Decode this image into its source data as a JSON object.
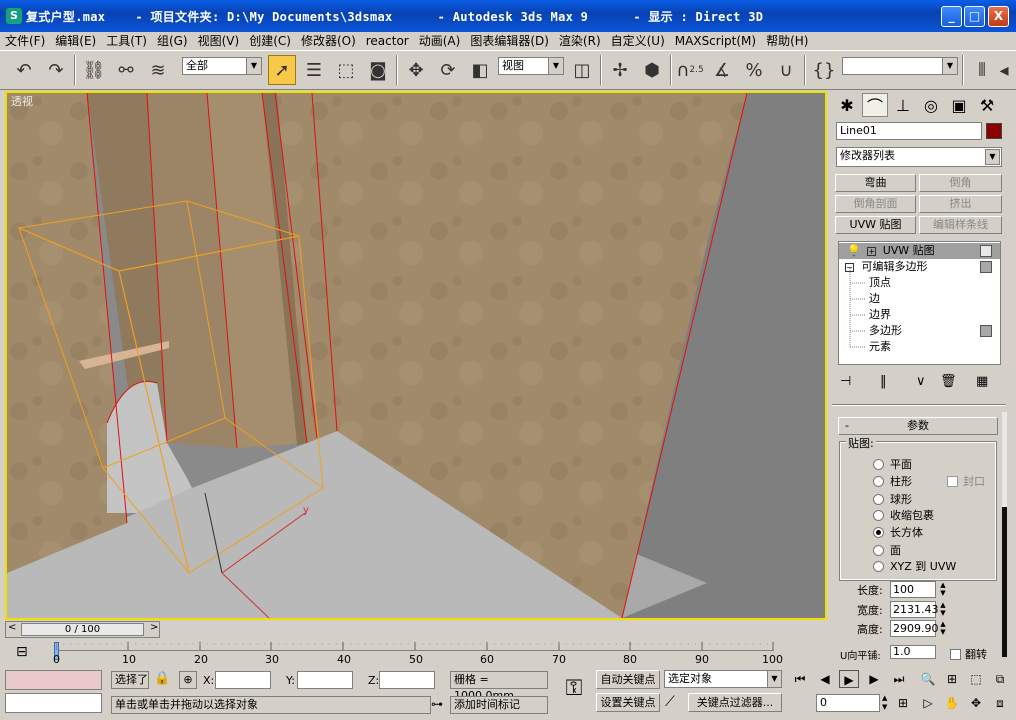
{
  "window": {
    "title": "复式户型.max    - 项目文件夹: D:\\My Documents\\3dsmax      - Autodesk 3ds Max 9      - 显示 : Direct 3D",
    "minimize": "_",
    "maximize": "□",
    "close": "X"
  },
  "menu": [
    "文件(F)",
    "编辑(E)",
    "工具(T)",
    "组(G)",
    "视图(V)",
    "创建(C)",
    "修改器(O)",
    "reactor",
    "动画(A)",
    "图表编辑器(D)",
    "渲染(R)",
    "自定义(U)",
    "MAXScript(M)",
    "帮助(H)"
  ],
  "toolbar": {
    "selection_filter": "全部",
    "coord_system": "视图",
    "named_selection": "",
    "snap_value": "2.5"
  },
  "viewport": {
    "label": "透视",
    "gizmo_axis": "y"
  },
  "panel": {
    "object_name": "Line01",
    "object_color": "#8b0000",
    "modifier_list": "修改器列表",
    "buttons": [
      {
        "label": "弯曲",
        "enabled": true
      },
      {
        "label": "倒角",
        "enabled": false
      },
      {
        "label": "倒角剖面",
        "enabled": false
      },
      {
        "label": "挤出",
        "enabled": false
      },
      {
        "label": "UVW 贴图",
        "enabled": true
      },
      {
        "label": "编辑样条线",
        "enabled": false
      }
    ],
    "stack": [
      {
        "label": "UVW 贴图",
        "level": 0,
        "selected": true
      },
      {
        "label": "可编辑多边形",
        "level": 0,
        "selected": false
      },
      {
        "label": "顶点",
        "level": 1
      },
      {
        "label": "边",
        "level": 1
      },
      {
        "label": "边界",
        "level": 1
      },
      {
        "label": "多边形",
        "level": 1
      },
      {
        "label": "元素",
        "level": 1
      }
    ],
    "rollout_title": "参数",
    "rollout_toggle": "-",
    "mapping_group": "贴图:",
    "mapping_options": [
      {
        "label": "平面",
        "checked": false
      },
      {
        "label": "柱形",
        "checked": false
      },
      {
        "label": "球形",
        "checked": false
      },
      {
        "label": "收缩包裹",
        "checked": false
      },
      {
        "label": "长方体",
        "checked": true
      },
      {
        "label": "面",
        "checked": false
      },
      {
        "label": "XYZ 到 UVW",
        "checked": false
      }
    ],
    "cap_label": "封口",
    "length_label": "长度:",
    "length_value": "100",
    "width_label": "宽度:",
    "width_value": "2131.43",
    "height_label": "高度:",
    "height_value": "2909.90",
    "utile_label": "U向平铺:",
    "utile_value": "1.0",
    "flip_label": "翻转"
  },
  "timeline": {
    "frame": "0 / 100",
    "ticks": [
      "0",
      "10",
      "20",
      "30",
      "40",
      "50",
      "60",
      "70",
      "80",
      "90",
      "100"
    ]
  },
  "status": {
    "selection": "选择了",
    "x_label": "X:",
    "y_label": "Y:",
    "z_label": "Z:",
    "grid": "栅格 = 1000.0mm",
    "auto_key": "自动关键点",
    "set_key": "设置关键点",
    "selected_object": "选定对象",
    "key_filters": "关键点过滤器...",
    "prompt": "单击或单击并拖动以选择对象",
    "add_time_tag": "添加时间标记",
    "frame_value": "0"
  }
}
